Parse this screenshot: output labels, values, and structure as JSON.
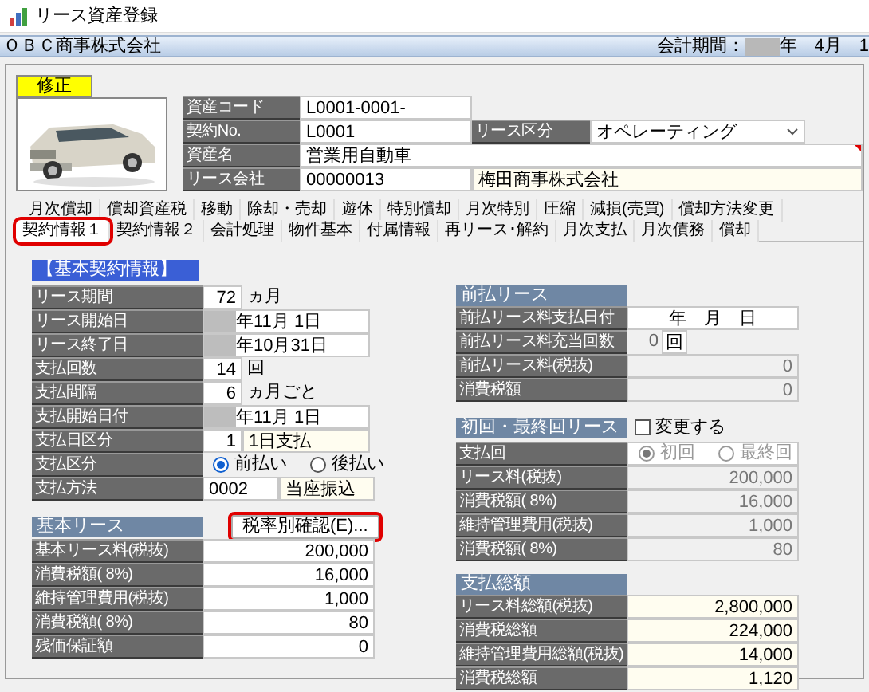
{
  "window": {
    "title": "リース資産登録"
  },
  "company_bar": {
    "company": "ＯＢＣ商事株式会社",
    "period_label": "会計期間：",
    "period_value": "年　4月　1"
  },
  "mode_badge": "修正",
  "asset_info": {
    "asset_code": {
      "label": "資産コード",
      "value": "L0001-0001-"
    },
    "contract_no": {
      "label": "契約No.",
      "value": "L0001"
    },
    "lease_type": {
      "label": "リース区分",
      "value": "オペレーティング"
    },
    "asset_name": {
      "label": "資産名",
      "value": "営業用自動車"
    },
    "lease_company": {
      "label": "リース会社",
      "code": "00000013",
      "name": "梅田商事株式会社"
    }
  },
  "tabs_row_1": [
    {
      "label": "月次償却",
      "selected": false
    },
    {
      "label": "償却資産税",
      "selected": false
    },
    {
      "label": "移動",
      "selected": false
    },
    {
      "label": "除却・売却",
      "selected": false
    },
    {
      "label": "遊休",
      "selected": false
    },
    {
      "label": "特別償却",
      "selected": false
    },
    {
      "label": "月次特別",
      "selected": false
    },
    {
      "label": "圧縮",
      "selected": false
    },
    {
      "label": "減損(売買)",
      "selected": false
    },
    {
      "label": "償却方法変更",
      "selected": false
    }
  ],
  "tabs_row_2": [
    {
      "label": "契約情報１",
      "selected": true
    },
    {
      "label": "契約情報２",
      "selected": false
    },
    {
      "label": "会計処理",
      "selected": false
    },
    {
      "label": "物件基本",
      "selected": false
    },
    {
      "label": "付属情報",
      "selected": false
    },
    {
      "label": "再リース･解約",
      "selected": false
    },
    {
      "label": "月次支払",
      "selected": false
    },
    {
      "label": "月次債務",
      "selected": false
    },
    {
      "label": "償却",
      "selected": false
    }
  ],
  "basic_contract": {
    "title": "【基本契約情報】",
    "rows": [
      {
        "kind": "number_unit",
        "label": "リース期間",
        "value": "72",
        "unit": "ヵ月"
      },
      {
        "kind": "date",
        "label": "リース開始日",
        "value": "年11月 1日"
      },
      {
        "kind": "date",
        "label": "リース終了日",
        "value": "年10月31日"
      },
      {
        "kind": "number_unit",
        "label": "支払回数",
        "value": "14",
        "unit": "回"
      },
      {
        "kind": "number_unit",
        "label": "支払間隔",
        "value": "6",
        "unit": "ヵ月ごと"
      },
      {
        "kind": "date",
        "label": "支払開始日付",
        "value": "年11月 1日"
      },
      {
        "kind": "code_name",
        "label": "支払日区分",
        "code": "1",
        "name": "1日支払"
      },
      {
        "kind": "radio",
        "label": "支払区分",
        "disabled": false,
        "options": [
          {
            "label": "前払い",
            "selected": true
          },
          {
            "label": "後払い",
            "selected": false
          }
        ]
      },
      {
        "kind": "code_name",
        "label": "支払方法",
        "code": "0002",
        "name": "当座振込"
      }
    ]
  },
  "basic_lease": {
    "title": "基本リース",
    "button": {
      "label": "税率別確認(E)...",
      "highlighted": true
    },
    "rows": [
      {
        "label": "基本リース料(税抜)",
        "value": "200,000",
        "disabled": false,
        "readonly": false
      },
      {
        "label": "消費税額( 8%)",
        "value": "16,000",
        "disabled": false,
        "readonly": false
      },
      {
        "label": "維持管理費用(税抜)",
        "value": "1,000",
        "disabled": false,
        "readonly": false
      },
      {
        "label": "消費税額( 8%)",
        "value": "80",
        "disabled": false,
        "readonly": false
      },
      {
        "label": "残価保証額",
        "value": "0",
        "disabled": false,
        "readonly": false
      }
    ]
  },
  "prepaid_lease": {
    "title": "前払リース",
    "rows": [
      {
        "kind": "blank_date",
        "label": "前払リース料支払日付",
        "value": "年　月　日"
      },
      {
        "kind": "boxed_unit",
        "label": "前払リース料充当回数",
        "value": "0",
        "unit": "回"
      },
      {
        "kind": "amount",
        "label": "前払リース料(税抜)",
        "value": "0",
        "disabled": true,
        "readonly": false
      },
      {
        "kind": "amount",
        "label": "消費税額",
        "value": "0",
        "disabled": true,
        "readonly": false
      }
    ]
  },
  "first_last_lease": {
    "title": "初回・最終回リース",
    "change_checkbox": {
      "label": "変更する",
      "checked": false
    },
    "rows": [
      {
        "kind": "radio",
        "label": "支払回",
        "disabled": true,
        "options": [
          {
            "label": "初回",
            "selected": true
          },
          {
            "label": "最終回",
            "selected": false
          }
        ]
      },
      {
        "kind": "amount",
        "label": "リース料(税抜)",
        "value": "200,000",
        "disabled": true,
        "readonly": false
      },
      {
        "kind": "amount",
        "label": "消費税額( 8%)",
        "value": "16,000",
        "disabled": true,
        "readonly": false
      },
      {
        "kind": "amount",
        "label": "維持管理費用(税抜)",
        "value": "1,000",
        "disabled": true,
        "readonly": false
      },
      {
        "kind": "amount",
        "label": "消費税額( 8%)",
        "value": "80",
        "disabled": true,
        "readonly": false
      }
    ]
  },
  "payment_total": {
    "title": "支払総額",
    "rows": [
      {
        "label": "リース料総額(税抜)",
        "value": "2,800,000",
        "disabled": false,
        "readonly": true
      },
      {
        "label": "消費税総額",
        "value": "224,000",
        "disabled": false,
        "readonly": true
      },
      {
        "label": "維持管理費用総額(税抜)",
        "value": "14,000",
        "disabled": false,
        "readonly": true
      },
      {
        "label": "消費税総額",
        "value": "1,120",
        "disabled": false,
        "readonly": true
      }
    ]
  }
}
